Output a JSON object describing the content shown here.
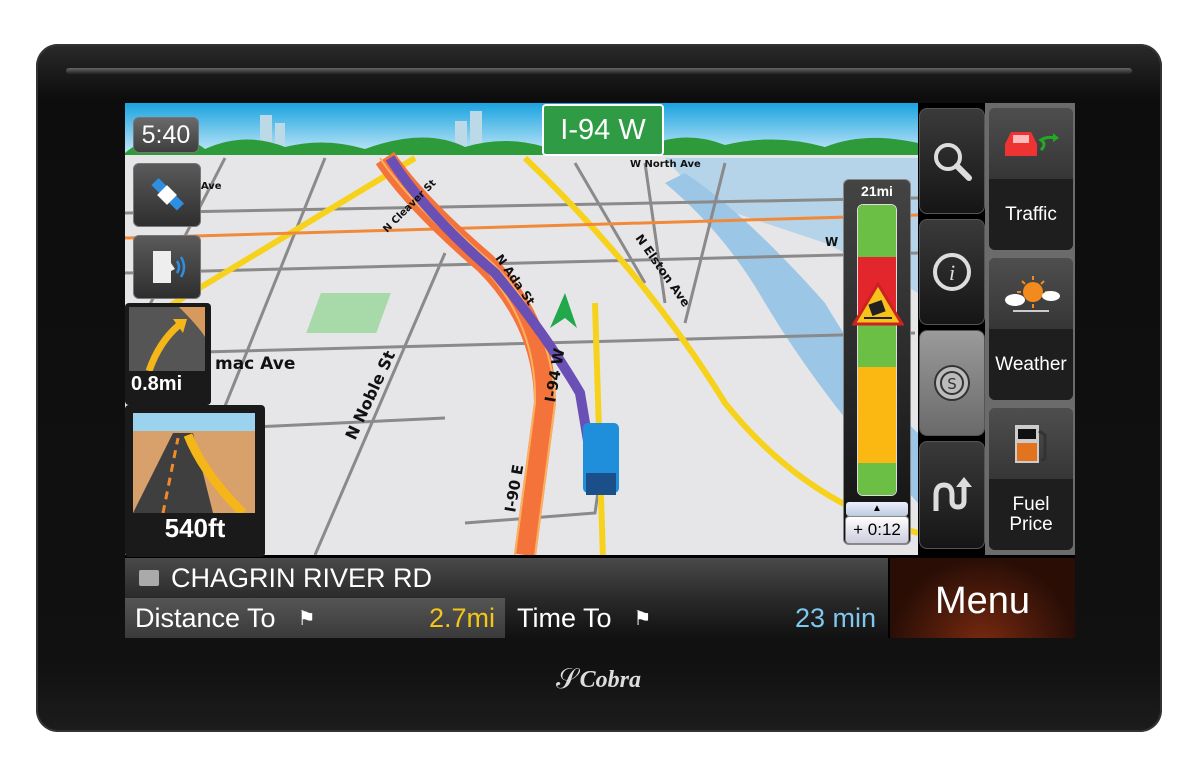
{
  "device": {
    "brand": "Cobra"
  },
  "status": {
    "time": "5:40"
  },
  "map": {
    "highway_sign": "I-94 W",
    "road_labels": [
      "W North Ave",
      "erce Ave",
      "N Cleaver St",
      "N Ada St",
      "N Elston Ave",
      "mac Ave",
      "N Noble St",
      "I-94 W",
      "I-90 E",
      "W"
    ]
  },
  "guidance": {
    "next_turn_distance": "0.8mi",
    "lane_assist_distance": "540ft"
  },
  "traffic_bar": {
    "distance": "21mi",
    "delay": "+ 0:12",
    "segments": [
      "green",
      "red",
      "green",
      "amber",
      "green"
    ],
    "colors": {
      "green": "#6cbf45",
      "red": "#e3262b",
      "amber": "#fbb813"
    }
  },
  "tool_buttons": [
    {
      "icon": "search-icon"
    },
    {
      "icon": "info-icon"
    },
    {
      "icon": "speed-camera-icon"
    },
    {
      "icon": "detour-icon"
    }
  ],
  "side_panels": [
    {
      "label": "Traffic",
      "icon": "traffic-car-icon"
    },
    {
      "label": "Weather",
      "icon": "weather-sun-cloud-icon"
    },
    {
      "label": "Fuel Price",
      "icon": "fuel-pump-icon"
    }
  ],
  "bottom": {
    "street": "CHAGRIN RIVER RD",
    "distance_label": "Distance To",
    "distance_value": "2.7mi",
    "time_label": "Time To",
    "time_value": "23 min",
    "menu": "Menu",
    "distance_color": "#f5c518",
    "time_color": "#7ec8f0"
  }
}
